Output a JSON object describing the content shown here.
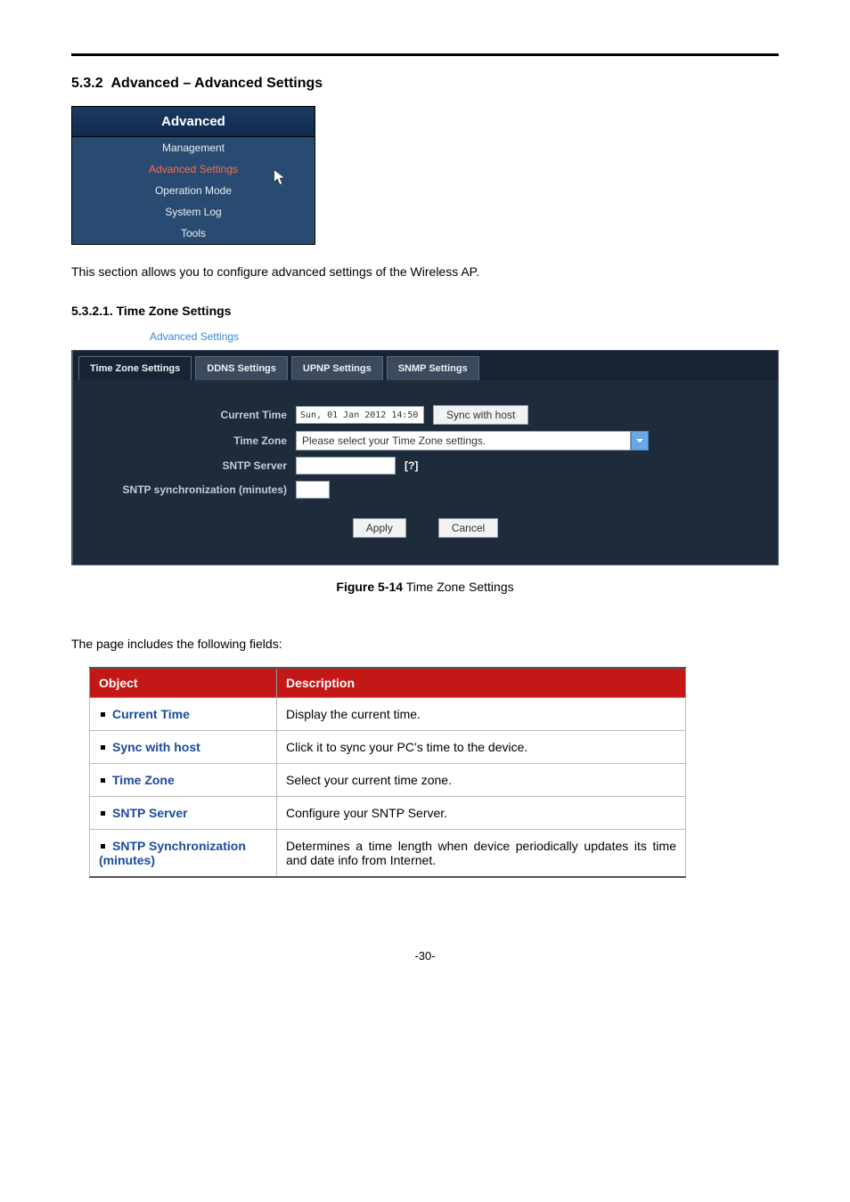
{
  "section_no": "5.3.2",
  "section_title": "Advanced – Advanced Settings",
  "sidebar": {
    "title": "Advanced",
    "items": [
      "Management",
      "Advanced Settings",
      "Operation Mode",
      "System Log",
      "Tools"
    ],
    "active_index": 1
  },
  "intro_text": "This section allows you to configure advanced settings of the Wireless AP.",
  "subsection_no": "5.3.2.1.",
  "subsection_title": "Time Zone Settings",
  "breadcrumb": "Advanced Settings",
  "tabs": [
    "Time Zone Settings",
    "DDNS Settings",
    "UPNP Settings",
    "SNMP Settings"
  ],
  "active_tab": 0,
  "form": {
    "current_time_label": "Current Time",
    "current_time_value": "Sun, 01 Jan 2012 14:50",
    "sync_btn": "Sync with host",
    "time_zone_label": "Time Zone",
    "time_zone_value": "Please select your Time Zone settings.",
    "sntp_label": "SNTP Server",
    "sntp_value": "",
    "sntp_hint": "[?]",
    "sync_min_label": "SNTP synchronization (minutes)",
    "sync_min_value": "",
    "apply": "Apply",
    "cancel": "Cancel"
  },
  "figure_no": "Figure 5-14",
  "figure_title": "Time Zone Settings",
  "fields_lead": "The page includes the following fields:",
  "table": {
    "headers": [
      "Object",
      "Description"
    ],
    "rows": [
      {
        "obj": "Current Time",
        "desc": "Display the current time."
      },
      {
        "obj": "Sync with host",
        "desc": "Click it to sync your PC’s time to the device."
      },
      {
        "obj": "Time Zone",
        "desc": "Select your current time zone."
      },
      {
        "obj": "SNTP Server",
        "desc": "Configure your SNTP Server."
      },
      {
        "obj": "SNTP Synchronization (minutes)",
        "desc": "Determines a time length when device periodically updates its time and date info from Internet."
      }
    ]
  },
  "page_no": "-30-"
}
